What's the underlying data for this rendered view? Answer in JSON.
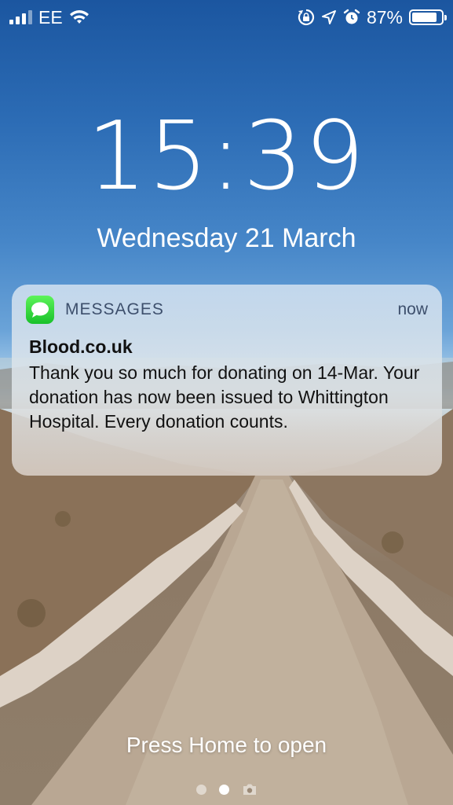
{
  "status_bar": {
    "carrier": "EE",
    "battery_percent_label": "87%",
    "battery_level": 0.87,
    "signal_bars_active": 3,
    "signal_bars_total": 4,
    "icons": [
      "wifi-icon",
      "rotation-lock-icon",
      "location-arrow-icon",
      "alarm-icon"
    ]
  },
  "lock_screen": {
    "time": "15:39",
    "date": "Wednesday 21 March",
    "home_hint": "Press Home to open"
  },
  "notification": {
    "app_icon": "messages-app-icon",
    "app_name": "MESSAGES",
    "time": "now",
    "sender": "Blood.co.uk",
    "body": "Thank you so much for donating on 14-Mar. Your donation has now been issued to Whittington Hospital. Every donation counts."
  },
  "page_indicator": {
    "pages": 2,
    "active_index": 1,
    "extra_icon": "camera-icon"
  },
  "colors": {
    "notification_accent": "#3d4f6c",
    "messages_green": "#19c12b"
  }
}
